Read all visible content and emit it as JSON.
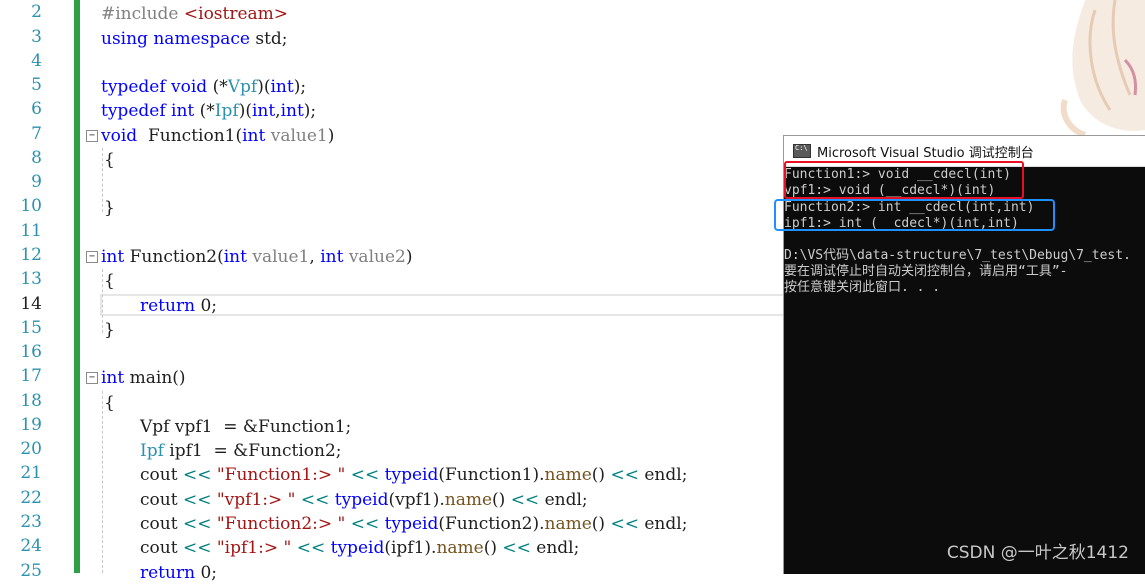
{
  "editor": {
    "line_numbers": [
      "2",
      "3",
      "4",
      "5",
      "6",
      "7",
      "8",
      "9",
      "10",
      "11",
      "12",
      "13",
      "14",
      "15",
      "16",
      "17",
      "18",
      "19",
      "20",
      "21",
      "22",
      "23",
      "24",
      "25"
    ],
    "current_line": "14",
    "lines": {
      "l2a": "#include ",
      "l2b": "<iostream>",
      "l3a": "using",
      "l3b": " ",
      "l3c": "namespace",
      "l3d": " std;",
      "l5a": "typedef",
      "l5b": " ",
      "l5c": "void",
      "l5d": " (*",
      "l5e": "Vpf",
      "l5f": ")(",
      "l5g": "int",
      "l5h": ");",
      "l6a": "typedef",
      "l6b": " ",
      "l6c": "int",
      "l6d": " (*",
      "l6e": "Ipf",
      "l6f": ")(",
      "l6g": "int",
      "l6h": ",",
      "l6i": "int",
      "l6j": ");",
      "l7a": "void",
      "l7b": "  Function1(",
      "l7c": "int",
      "l7d": " ",
      "l7e": "value1",
      "l7f": ")",
      "l8": "{",
      "l10": "}",
      "l12a": "int",
      "l12b": " Function2(",
      "l12c": "int",
      "l12d": " ",
      "l12e": "value1",
      "l12f": ", ",
      "l12g": "int",
      "l12h": " ",
      "l12i": "value2",
      "l12j": ")",
      "l13": "{",
      "l14a": "return",
      "l14b": " 0;",
      "l15": "}",
      "l17a": "int",
      "l17b": " main()",
      "l18": "{",
      "l19a": "Vpf",
      "l19b": " vpf1  = &Function1;",
      "l20a": "Ipf",
      "l20b": " ipf1  = &Function2;",
      "l21a": "cout ",
      "l21b": "<<",
      "l21c": " ",
      "l21d": "\"Function1:> \"",
      "l21e": " ",
      "l21f": "<<",
      "l21g": " ",
      "l21h": "typeid",
      "l21i": "(Function1).",
      "l21j": "name",
      "l21k": "() ",
      "l21l": "<<",
      "l21m": " endl;",
      "l22a": "cout ",
      "l22b": "<<",
      "l22c": " ",
      "l22d": "\"vpf1:> \"",
      "l22e": " ",
      "l22f": "<<",
      "l22g": " ",
      "l22h": "typeid",
      "l22i": "(vpf1).",
      "l22j": "name",
      "l22k": "() ",
      "l22l": "<<",
      "l22m": " endl;",
      "l23a": "cout ",
      "l23b": "<<",
      "l23c": " ",
      "l23d": "\"Function2:> \"",
      "l23e": " ",
      "l23f": "<<",
      "l23g": " ",
      "l23h": "typeid",
      "l23i": "(Function2).",
      "l23j": "name",
      "l23k": "() ",
      "l23l": "<<",
      "l23m": " endl;",
      "l24a": "cout ",
      "l24b": "<<",
      "l24c": " ",
      "l24d": "\"ipf1:> \"",
      "l24e": " ",
      "l24f": "<<",
      "l24g": " ",
      "l24h": "typeid",
      "l24i": "(ipf1).",
      "l24j": "name",
      "l24k": "() ",
      "l24l": "<<",
      "l24m": " endl;",
      "l25a": "return",
      "l25b": " 0;"
    }
  },
  "console": {
    "title": "Microsoft Visual Studio 调试控制台",
    "icon": "console-app-icon",
    "output": [
      "Function1:> void __cdecl(int)",
      "vpf1:> void (__cdecl*)(int)",
      "Function2:> int __cdecl(int,int)",
      "ipf1:> int (__cdecl*)(int,int)",
      "",
      "D:\\VS代码\\data-structure\\7_test\\Debug\\7_test.",
      "要在调试停止时自动关闭控制台，请启用“工具”-",
      "按任意键关闭此窗口. . ."
    ]
  },
  "watermark": "CSDN @一叶之秋1412",
  "colors": {
    "keyword": "#0000ff",
    "type": "#2b91af",
    "string": "#a31515",
    "highlight_red": "#e81123",
    "highlight_blue": "#1e90ff",
    "change_bar": "#2ea043"
  }
}
